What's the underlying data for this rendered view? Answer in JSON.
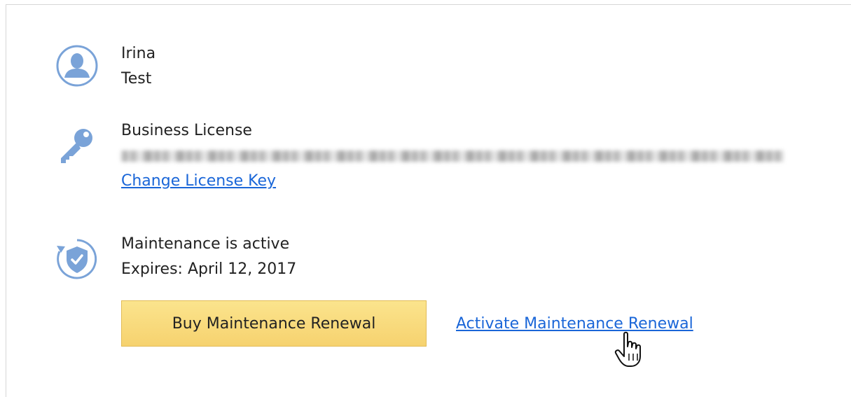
{
  "user": {
    "first_name": "Irina",
    "last_name": "Test",
    "icon": "user-avatar-icon"
  },
  "license": {
    "type": "Business License",
    "key_display": "blurred license key",
    "change_link": "Change License Key",
    "icon": "key-icon"
  },
  "maintenance": {
    "status": "Maintenance is active",
    "expires": "Expires: April 12, 2017",
    "icon": "shield-refresh-icon",
    "buy_button": "Buy Maintenance Renewal",
    "activate_link": "Activate Maintenance Renewal"
  },
  "colors": {
    "icon_blue": "#7aa3d8",
    "link": "#1a66d8",
    "button_fill": "#f8da7a",
    "button_border": "#e2bc58"
  }
}
